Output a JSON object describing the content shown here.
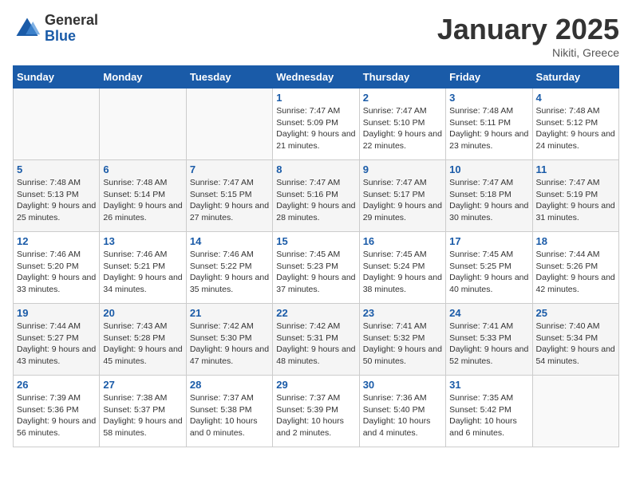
{
  "logo": {
    "general": "General",
    "blue": "Blue"
  },
  "title": "January 2025",
  "subtitle": "Nikiti, Greece",
  "days_of_week": [
    "Sunday",
    "Monday",
    "Tuesday",
    "Wednesday",
    "Thursday",
    "Friday",
    "Saturday"
  ],
  "weeks": [
    [
      {
        "day": "",
        "info": ""
      },
      {
        "day": "",
        "info": ""
      },
      {
        "day": "",
        "info": ""
      },
      {
        "day": "1",
        "info": "Sunrise: 7:47 AM\nSunset: 5:09 PM\nDaylight: 9 hours\nand 21 minutes."
      },
      {
        "day": "2",
        "info": "Sunrise: 7:47 AM\nSunset: 5:10 PM\nDaylight: 9 hours\nand 22 minutes."
      },
      {
        "day": "3",
        "info": "Sunrise: 7:48 AM\nSunset: 5:11 PM\nDaylight: 9 hours\nand 23 minutes."
      },
      {
        "day": "4",
        "info": "Sunrise: 7:48 AM\nSunset: 5:12 PM\nDaylight: 9 hours\nand 24 minutes."
      }
    ],
    [
      {
        "day": "5",
        "info": "Sunrise: 7:48 AM\nSunset: 5:13 PM\nDaylight: 9 hours\nand 25 minutes."
      },
      {
        "day": "6",
        "info": "Sunrise: 7:48 AM\nSunset: 5:14 PM\nDaylight: 9 hours\nand 26 minutes."
      },
      {
        "day": "7",
        "info": "Sunrise: 7:47 AM\nSunset: 5:15 PM\nDaylight: 9 hours\nand 27 minutes."
      },
      {
        "day": "8",
        "info": "Sunrise: 7:47 AM\nSunset: 5:16 PM\nDaylight: 9 hours\nand 28 minutes."
      },
      {
        "day": "9",
        "info": "Sunrise: 7:47 AM\nSunset: 5:17 PM\nDaylight: 9 hours\nand 29 minutes."
      },
      {
        "day": "10",
        "info": "Sunrise: 7:47 AM\nSunset: 5:18 PM\nDaylight: 9 hours\nand 30 minutes."
      },
      {
        "day": "11",
        "info": "Sunrise: 7:47 AM\nSunset: 5:19 PM\nDaylight: 9 hours\nand 31 minutes."
      }
    ],
    [
      {
        "day": "12",
        "info": "Sunrise: 7:46 AM\nSunset: 5:20 PM\nDaylight: 9 hours\nand 33 minutes."
      },
      {
        "day": "13",
        "info": "Sunrise: 7:46 AM\nSunset: 5:21 PM\nDaylight: 9 hours\nand 34 minutes."
      },
      {
        "day": "14",
        "info": "Sunrise: 7:46 AM\nSunset: 5:22 PM\nDaylight: 9 hours\nand 35 minutes."
      },
      {
        "day": "15",
        "info": "Sunrise: 7:45 AM\nSunset: 5:23 PM\nDaylight: 9 hours\nand 37 minutes."
      },
      {
        "day": "16",
        "info": "Sunrise: 7:45 AM\nSunset: 5:24 PM\nDaylight: 9 hours\nand 38 minutes."
      },
      {
        "day": "17",
        "info": "Sunrise: 7:45 AM\nSunset: 5:25 PM\nDaylight: 9 hours\nand 40 minutes."
      },
      {
        "day": "18",
        "info": "Sunrise: 7:44 AM\nSunset: 5:26 PM\nDaylight: 9 hours\nand 42 minutes."
      }
    ],
    [
      {
        "day": "19",
        "info": "Sunrise: 7:44 AM\nSunset: 5:27 PM\nDaylight: 9 hours\nand 43 minutes."
      },
      {
        "day": "20",
        "info": "Sunrise: 7:43 AM\nSunset: 5:28 PM\nDaylight: 9 hours\nand 45 minutes."
      },
      {
        "day": "21",
        "info": "Sunrise: 7:42 AM\nSunset: 5:30 PM\nDaylight: 9 hours\nand 47 minutes."
      },
      {
        "day": "22",
        "info": "Sunrise: 7:42 AM\nSunset: 5:31 PM\nDaylight: 9 hours\nand 48 minutes."
      },
      {
        "day": "23",
        "info": "Sunrise: 7:41 AM\nSunset: 5:32 PM\nDaylight: 9 hours\nand 50 minutes."
      },
      {
        "day": "24",
        "info": "Sunrise: 7:41 AM\nSunset: 5:33 PM\nDaylight: 9 hours\nand 52 minutes."
      },
      {
        "day": "25",
        "info": "Sunrise: 7:40 AM\nSunset: 5:34 PM\nDaylight: 9 hours\nand 54 minutes."
      }
    ],
    [
      {
        "day": "26",
        "info": "Sunrise: 7:39 AM\nSunset: 5:36 PM\nDaylight: 9 hours\nand 56 minutes."
      },
      {
        "day": "27",
        "info": "Sunrise: 7:38 AM\nSunset: 5:37 PM\nDaylight: 9 hours\nand 58 minutes."
      },
      {
        "day": "28",
        "info": "Sunrise: 7:37 AM\nSunset: 5:38 PM\nDaylight: 10 hours\nand 0 minutes."
      },
      {
        "day": "29",
        "info": "Sunrise: 7:37 AM\nSunset: 5:39 PM\nDaylight: 10 hours\nand 2 minutes."
      },
      {
        "day": "30",
        "info": "Sunrise: 7:36 AM\nSunset: 5:40 PM\nDaylight: 10 hours\nand 4 minutes."
      },
      {
        "day": "31",
        "info": "Sunrise: 7:35 AM\nSunset: 5:42 PM\nDaylight: 10 hours\nand 6 minutes."
      },
      {
        "day": "",
        "info": ""
      }
    ]
  ]
}
